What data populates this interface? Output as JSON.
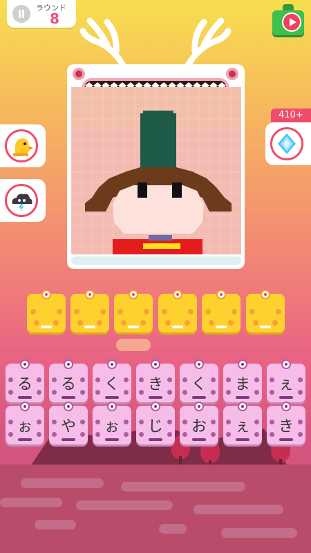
{
  "header": {
    "round_label": "ラウンド",
    "round_number": "8"
  },
  "powerups": {
    "gem_count": "410+"
  },
  "answer_slots": [
    {
      "filled": ""
    },
    {
      "filled": ""
    },
    {
      "filled": ""
    },
    {
      "filled": ""
    },
    {
      "filled": ""
    },
    {
      "filled": ""
    }
  ],
  "letter_tiles": {
    "row1": [
      "る",
      "る",
      "く",
      "き",
      "く",
      "ま",
      "ぇ"
    ],
    "row2": [
      "ぉ",
      "や",
      "ぉ",
      "じ",
      "お",
      "ぇ",
      "き"
    ]
  },
  "colors": {
    "accent": "#f04b6a",
    "slot_yellow": "#ffd12e",
    "tile_pink": "#f6bde9"
  }
}
